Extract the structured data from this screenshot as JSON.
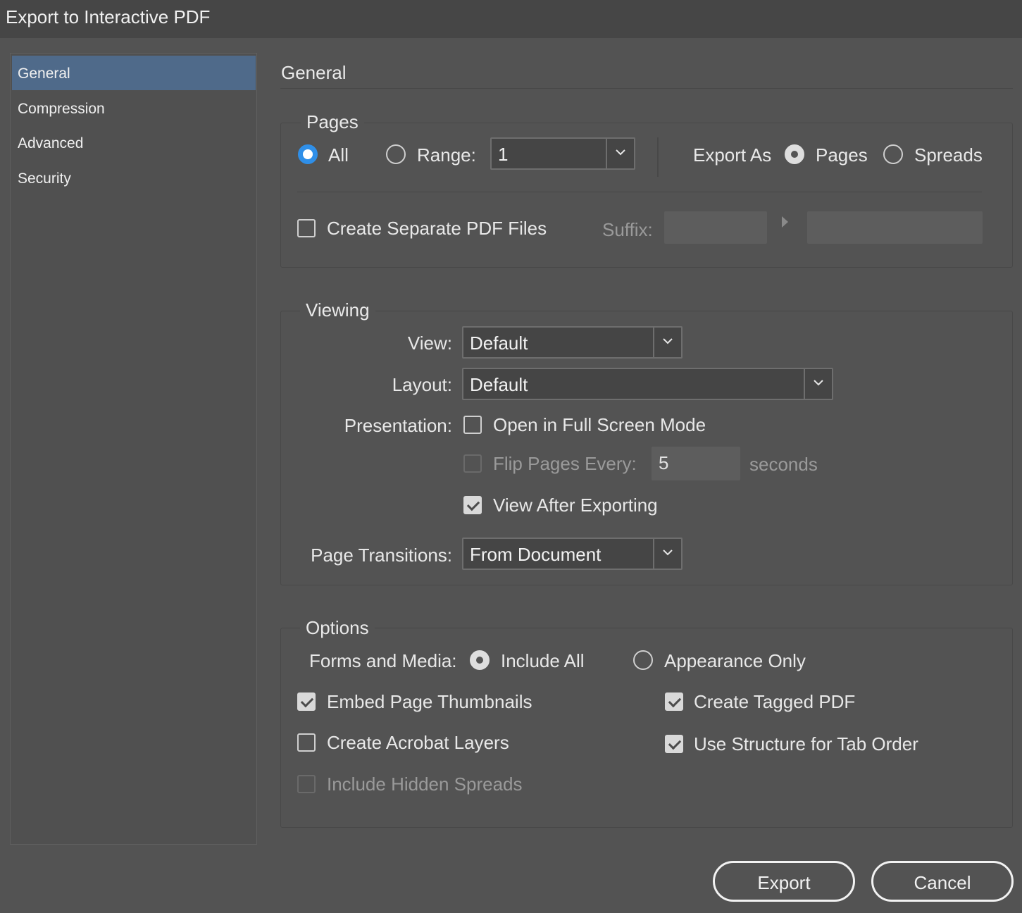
{
  "window": {
    "title": "Export to Interactive PDF"
  },
  "sidebar": {
    "items": [
      {
        "label": "General",
        "selected": true
      },
      {
        "label": "Compression",
        "selected": false
      },
      {
        "label": "Advanced",
        "selected": false
      },
      {
        "label": "Security",
        "selected": false
      }
    ]
  },
  "main": {
    "heading": "General",
    "pages": {
      "legend": "Pages",
      "all_label": "All",
      "all_selected": true,
      "range_label": "Range:",
      "range_value": "1",
      "export_as_label": "Export As",
      "export_as_pages": "Pages",
      "export_as_spreads": "Spreads",
      "export_as_selected": "Pages",
      "separate_files_label": "Create Separate PDF Files",
      "separate_files_checked": false,
      "suffix_label": "Suffix:"
    },
    "viewing": {
      "legend": "Viewing",
      "view_label": "View:",
      "view_value": "Default",
      "layout_label": "Layout:",
      "layout_value": "Default",
      "presentation_label": "Presentation:",
      "full_screen_label": "Open in Full Screen Mode",
      "full_screen_checked": false,
      "flip_pages_label": "Flip Pages Every:",
      "flip_pages_value": "5",
      "flip_pages_unit": "seconds",
      "view_after_label": "View After Exporting",
      "view_after_checked": true,
      "transitions_label": "Page Transitions:",
      "transitions_value": "From Document"
    },
    "options": {
      "legend": "Options",
      "forms_media_label": "Forms and Media:",
      "include_all_label": "Include All",
      "appearance_only_label": "Appearance Only",
      "forms_media_selected": "Include All",
      "embed_thumbnails_label": "Embed Page Thumbnails",
      "embed_thumbnails_checked": true,
      "acrobat_layers_label": "Create Acrobat Layers",
      "acrobat_layers_checked": false,
      "hidden_spreads_label": "Include Hidden Spreads",
      "hidden_spreads_checked": false,
      "tagged_pdf_label": "Create Tagged PDF",
      "tagged_pdf_checked": true,
      "tab_order_label": "Use Structure for Tab Order",
      "tab_order_checked": true
    }
  },
  "footer": {
    "export_label": "Export",
    "cancel_label": "Cancel"
  }
}
